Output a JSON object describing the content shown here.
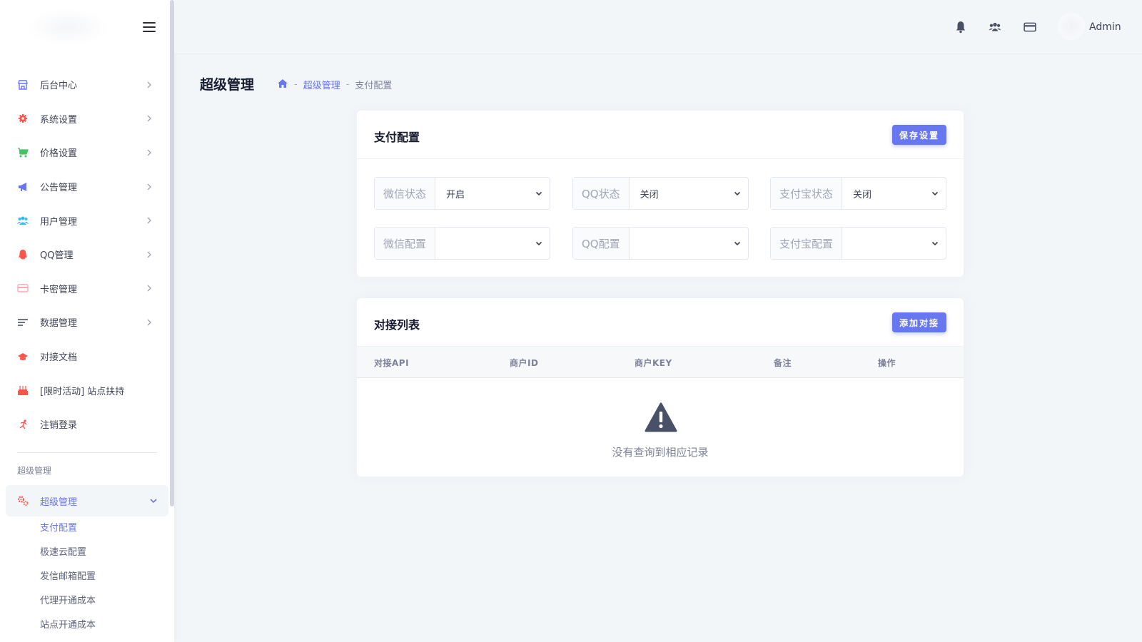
{
  "sidebar": {
    "items": [
      {
        "label": "后台中心",
        "icon": "store-icon",
        "color": "#6777ef"
      },
      {
        "label": "系统设置",
        "icon": "gear-icon",
        "color": "#fc544b"
      },
      {
        "label": "价格设置",
        "icon": "cart-icon",
        "color": "#47c363"
      },
      {
        "label": "公告管理",
        "icon": "megaphone-icon",
        "color": "#6777ef"
      },
      {
        "label": "用户管理",
        "icon": "users-icon",
        "color": "#3abaf4"
      },
      {
        "label": "QQ管理",
        "icon": "qq-icon",
        "color": "#fc544b"
      },
      {
        "label": "卡密管理",
        "icon": "card-icon",
        "color": "#f7a8b8"
      },
      {
        "label": "数据管理",
        "icon": "list-icon",
        "color": "#3f4254"
      },
      {
        "label": "对接文档",
        "icon": "graduation-cap-icon",
        "color": "#fc544b"
      },
      {
        "label": "[限时活动] 站点扶持",
        "icon": "cake-icon",
        "color": "#fc544b"
      },
      {
        "label": "注销登录",
        "icon": "runner-icon",
        "color": "#fc544b"
      }
    ],
    "section_title": "超级管理",
    "active_item": {
      "label": "超级管理",
      "icon": "gears-icon",
      "color": "#fc544b"
    },
    "submenu": [
      "支付配置",
      "极速云配置",
      "发信邮箱配置",
      "代理开通成本",
      "站点开通成本"
    ]
  },
  "header": {
    "icons": [
      "bell-icon",
      "group-icon",
      "credit-card-icon"
    ],
    "user_name": "Admin"
  },
  "page": {
    "title": "超级管理",
    "breadcrumb": [
      "超级管理",
      "支付配置"
    ]
  },
  "payment_config": {
    "title": "支付配置",
    "save_label": "保存设置",
    "fields": [
      {
        "label": "微信状态",
        "value": "开启"
      },
      {
        "label": "QQ状态",
        "value": "关闭"
      },
      {
        "label": "支付宝状态",
        "value": "关闭"
      },
      {
        "label": "微信配置",
        "value": ""
      },
      {
        "label": "QQ配置",
        "value": ""
      },
      {
        "label": "支付宝配置",
        "value": ""
      }
    ]
  },
  "integration_list": {
    "title": "对接列表",
    "add_label": "添加对接",
    "columns": [
      "对接API",
      "商户ID",
      "商户KEY",
      "备注",
      "操作"
    ],
    "empty_text": "没有查询到相应记录"
  },
  "colors": {
    "accent": "#6777ef",
    "text": "#3f4254"
  }
}
